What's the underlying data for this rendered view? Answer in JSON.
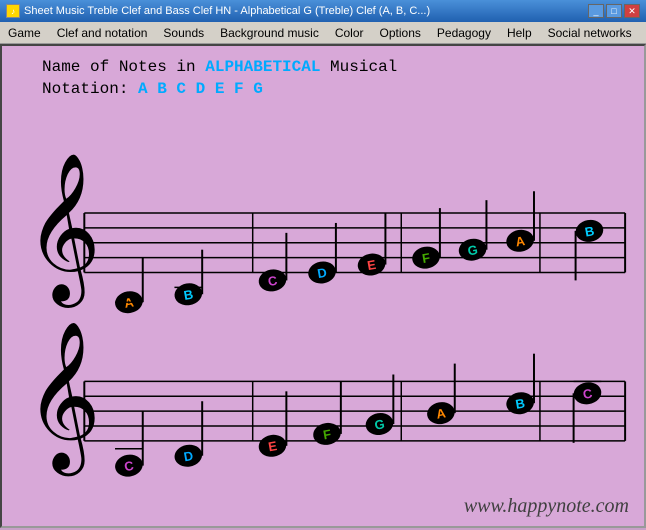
{
  "window": {
    "title": "Sheet Music Treble Clef and Bass Clef HN - Alphabetical G (Treble) Clef (A, B, C...)"
  },
  "menu": {
    "items": [
      "Game",
      "Clef and notation",
      "Sounds",
      "Background music",
      "Color",
      "Options",
      "Pedagogy",
      "Help",
      "Social networks"
    ]
  },
  "header": {
    "line1_prefix": "Name of Notes in ",
    "line1_highlight": "ALPHABETICAL",
    "line1_suffix": " Musical",
    "line2_prefix": "Notation: ",
    "line2_notes": "A  B  C  D  E  F  G"
  },
  "footer": {
    "url": "www.happynote.com"
  },
  "notes_row1": [
    {
      "letter": "A",
      "color": "#ff8800"
    },
    {
      "letter": "B",
      "color": "#00ccff"
    },
    {
      "letter": "C",
      "color": "#cc44cc"
    },
    {
      "letter": "D",
      "color": "#00aaff"
    },
    {
      "letter": "E",
      "color": "#ff4444"
    },
    {
      "letter": "F",
      "color": "#44aa00"
    },
    {
      "letter": "G",
      "color": "#00ccaa"
    },
    {
      "letter": "A",
      "color": "#ff8800"
    },
    {
      "letter": "B",
      "color": "#00ccff"
    }
  ],
  "notes_row2": [
    {
      "letter": "C",
      "color": "#cc44cc"
    },
    {
      "letter": "D",
      "color": "#00aaff"
    },
    {
      "letter": "E",
      "color": "#ff4444"
    },
    {
      "letter": "F",
      "color": "#44aa00"
    },
    {
      "letter": "G",
      "color": "#00ccaa"
    },
    {
      "letter": "A",
      "color": "#ff8800"
    },
    {
      "letter": "B",
      "color": "#00ccff"
    },
    {
      "letter": "C",
      "color": "#cc44cc"
    }
  ]
}
